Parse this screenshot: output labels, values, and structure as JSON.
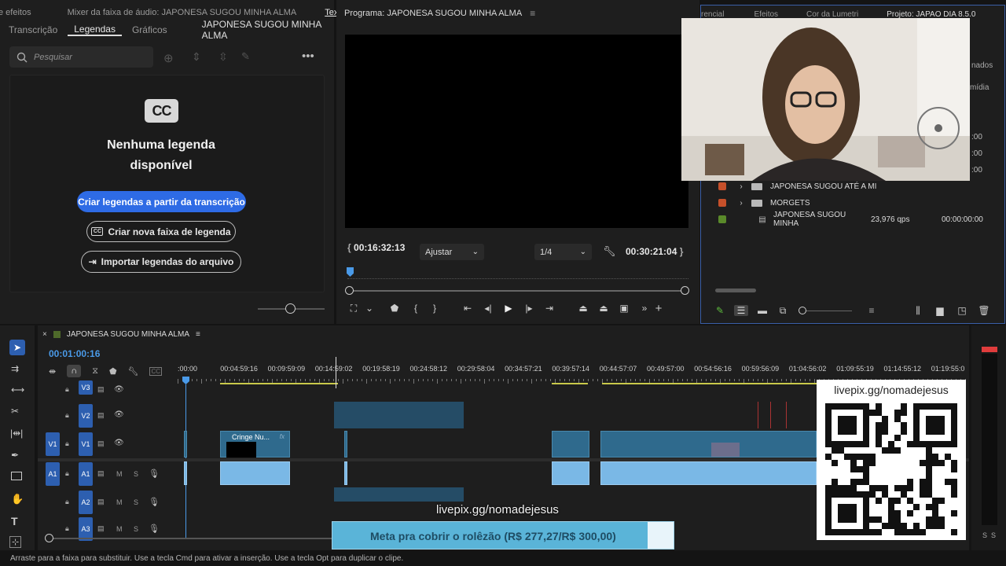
{
  "left_panel": {
    "top_tabs": [
      "e efeitos",
      "Mixer da faixa de áudio: JAPONESA SUGOU MINHA ALMA",
      "Texto"
    ],
    "sub_tabs": [
      "Transcrição",
      "Legendas",
      "Gráficos"
    ],
    "active_sub_tab": "Legendas",
    "sequence_name": "JAPONESA SUGOU MINHA ALMA",
    "search_placeholder": "Pesquisar",
    "cc_badge": "CC",
    "empty_title_line1": "Nenhuma legenda",
    "empty_title_line2": "disponível",
    "btn_create_from_transcript": "Criar legendas a partir da transcrição",
    "btn_new_caption_track": "Criar nova faixa de legenda",
    "btn_import_captions": "Importar legendas do arquivo"
  },
  "program_monitor": {
    "title": "Programa: JAPONESA SUGOU MINHA ALMA",
    "timecode_current": "00:16:32:13",
    "fit_label": "Ajustar",
    "resolution": "1/4",
    "timecode_duration": "00:30:21:04"
  },
  "project_panel": {
    "tabs": [
      "rencial",
      "Efeitos",
      "Cor da Lumetri",
      "Projeto: JAPAO DIA 8.5.0"
    ],
    "side_labels": [
      "nados",
      "mídia"
    ],
    "items": [
      {
        "name": "JAPONESA SUGOU ATÉ A MI",
        "type": "folder",
        "color": "#c6502a",
        "fps": "",
        "start": ""
      },
      {
        "name": "MORGETS",
        "type": "folder",
        "color": "#c6502a",
        "fps": "",
        "start": ""
      },
      {
        "name": "JAPONESA SUGOU MINHA",
        "type": "sequence",
        "color": "#5a8a2a",
        "fps": "23,976 qps",
        "start": "00:00:00:00"
      }
    ],
    "partial_times": [
      ":00",
      ":00",
      ":00"
    ]
  },
  "timeline": {
    "sequence_name": "JAPONESA SUGOU MINHA ALMA",
    "playhead_timecode": "00:01:00:16",
    "ruler_labels": [
      ":00:00",
      "00:04:59:16",
      "00:09:59:09",
      "00:14:59:02",
      "00:19:58:19",
      "00:24:58:12",
      "00:29:58:04",
      "00:34:57:21",
      "00:39:57:14",
      "00:44:57:07",
      "00:49:57:00",
      "00:54:56:16",
      "00:59:56:09",
      "01:04:56:02",
      "01:09:55:19",
      "01:14:55:12",
      "01:19:55:0"
    ],
    "tracks": {
      "v3": "V3",
      "v2": "V2",
      "v1_src": "V1",
      "v1": "V1",
      "a1_src": "A1",
      "a1": "A1",
      "a2": "A2",
      "a3": "A3",
      "m": "M",
      "s": "S"
    },
    "clip_label": "Cringe Nu...",
    "fx_label": "fx"
  },
  "overlay": {
    "qr_url": "livepix.gg/nomadejesus",
    "stream_url": "livepix.gg/nomadejesus",
    "goal_text": "Meta pra cobrir o rolêzão (R$ 277,27/R$ 300,00)",
    "goal_progress": 0.924
  },
  "audio_meter": {
    "labels": [
      "S",
      "S"
    ]
  },
  "status_bar": {
    "text": "Arraste para a faixa para substituir. Use a tecla Cmd para ativar a inserção. Use a tecla Opt para duplicar o clipe."
  },
  "colors": {
    "accent_blue": "#2e6be5",
    "track_blue": "#2d5fb0",
    "video_clip": "#2f6a8d",
    "audio_clip": "#7ab8e6",
    "timecode_blue": "#4a9ae8",
    "goal_bar": "#5ab4d8"
  }
}
